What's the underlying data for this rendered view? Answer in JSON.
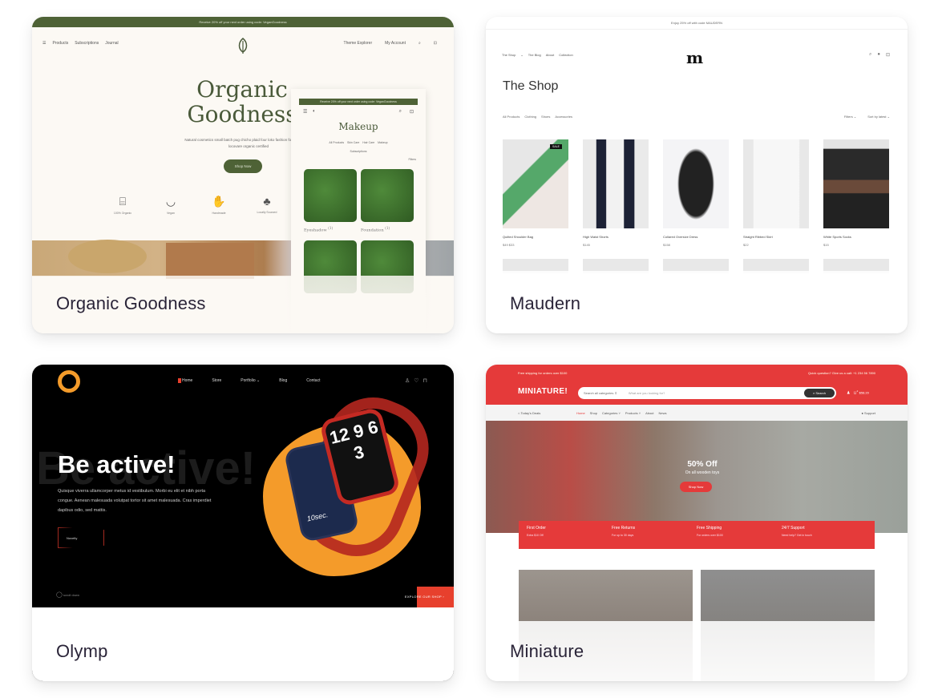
{
  "cards": [
    {
      "title": "Organic Goodness",
      "accent": "#4e6236",
      "promo_bar": "Receive 20% off your next order using code: VeganGoodness",
      "nav_left": [
        "Products",
        "Subscriptions",
        "Journal"
      ],
      "nav_right": [
        "Theme Explorer",
        "My Account"
      ],
      "hero_title_line1": "Organic",
      "hero_title_line2": "Goodness",
      "hero_text": "Natural cosmetics small batch pug chicho plaid four loko fashion four delte heart locovare organic certified",
      "hero_button": "Shop Now",
      "features": [
        "100% Organic",
        "Vegan",
        "Handmade",
        "Locally Sourced"
      ],
      "mobile": {
        "promo_bar": "Receive 20% off your next order using code: VeganGoodness",
        "title": "Makeup",
        "categories": [
          "All Products",
          "Skin Care",
          "Hair Care",
          "Makeup",
          "Subscriptions"
        ],
        "filter_label": "Filters",
        "products": [
          {
            "name": "Eyeshadow",
            "sup": "(1)"
          },
          {
            "name": "Foundation",
            "sup": "(1)"
          }
        ]
      }
    },
    {
      "title": "Maudern",
      "promo_bar": "Enjoy 25% off with code MAUDERN",
      "nav_left": [
        "The Shop",
        "The Blog",
        "About",
        "Collection"
      ],
      "logo": "m",
      "page_title": "The Shop",
      "categories": [
        "All Products",
        "Clothing",
        "Shoes",
        "Accessories"
      ],
      "filters_label": "Filters",
      "sort_label": "Sort by latest",
      "sale_badge": "SALE",
      "products": [
        {
          "name": "Quilted Shoulder Bag",
          "price": "$49 $33"
        },
        {
          "name": "High Waist Shorts",
          "price": "$145"
        },
        {
          "name": "Collared Oversize Dress",
          "price": "$158"
        },
        {
          "name": "Straight Ribbed Skirt",
          "price": "$22"
        },
        {
          "name": "White Sports Socks",
          "price": "$15"
        }
      ]
    },
    {
      "title": "Olymp",
      "accent": "#e7402d",
      "logo_color": "#f49b2a",
      "nav": [
        "Home",
        "Store",
        "Portfolio",
        "Blog",
        "Contact"
      ],
      "ghost_text": "Be active!",
      "hero_title": "Be active!",
      "hero_text": "Quisque viverra ullamcorper metus id vestibulum. Morbi eu elit et nibh porta congue. Aenean malesuada volutpat tortor sit amet malesuada. Cras imperdiet dapibus odio, sed mattis.",
      "hero_button": "Novelty",
      "scroll_label": "scroll down",
      "explore_label": "EXPLORE OUR SHOP",
      "watch_face": "12 9 6 3",
      "watch_small": "10sec."
    },
    {
      "title": "Miniature",
      "accent": "#e53a3a",
      "top_left": "Free shipping for orders over $100",
      "top_right": "Quick question? Give us a call: +1 234 56 7890",
      "logo": "MINIATURE!",
      "search_category": "Search all categories",
      "search_placeholder": "What are you looking for?",
      "search_button": "Search",
      "cart_total": "$58.20",
      "cart_count": "2",
      "todays_deals": "Today's Deals",
      "menu": [
        "Home",
        "Shop",
        "Categories",
        "Products",
        "About",
        "News"
      ],
      "support": "Support",
      "hero_title": "50% Off",
      "hero_subtitle": "On all wooden toys",
      "hero_button": "Shop Now",
      "features": [
        {
          "title": "First Order",
          "sub": "Extra $10 Off"
        },
        {
          "title": "Free Returns",
          "sub": "For up to 30 days"
        },
        {
          "title": "Free Shipping",
          "sub": "For orders over $100"
        },
        {
          "title": "24/7 Support",
          "sub": "Need help? Get in touch"
        }
      ]
    }
  ]
}
